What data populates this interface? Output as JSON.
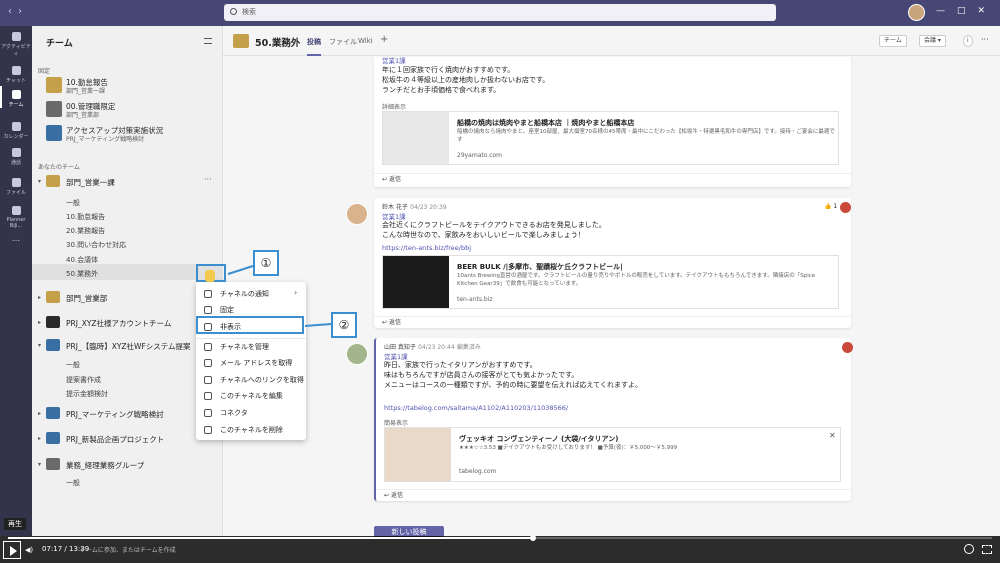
{
  "search": {
    "placeholder": "検索"
  },
  "rail": [
    {
      "label": "アクティビティ"
    },
    {
      "label": "チャット"
    },
    {
      "label": "チーム"
    },
    {
      "label": "カレンダー"
    },
    {
      "label": "通話"
    },
    {
      "label": "ファイル"
    },
    {
      "label": "Planner BiJi..."
    },
    {
      "label": "..."
    }
  ],
  "teams_panel": {
    "title": "チーム",
    "section_pinned": "固定",
    "section_yours": "あなたのチーム",
    "pinned": [
      {
        "name": "10.勤怠報告",
        "sub": "部門_営業一課"
      },
      {
        "name": "00.管理職限定",
        "sub": "部門_営業部"
      },
      {
        "name": "アクセスアップ対策実施状況",
        "sub": "PRJ_マーケティング戦略検討"
      }
    ],
    "team_eigyo1": "部門_営業一課",
    "channels_eigyo1": [
      "一般",
      "10.勤怠報告",
      "20.業務報告",
      "30.問い合わせ対応",
      "40.会議体",
      "50.業務外"
    ],
    "team_eigyobu": "部門_営業部",
    "team_xyz_account": "PRJ_XYZ社様アカウントチーム",
    "team_xyz_wf": "PRJ_【臨時】XYZ社WFシステム提案",
    "channels_xyz_wf": [
      "一般",
      "提案書作成",
      "提示金額検討"
    ],
    "team_marketing": "PRJ_マーケティング戦略検討",
    "team_newproduct": "PRJ_新製品企画プロジェクト",
    "team_keiri": "業務_経理業務グループ",
    "channels_keiri": [
      "一般"
    ],
    "join_text": "チームに参加、またはチームを作成"
  },
  "header": {
    "channel_title": "50.業務外",
    "tabs": [
      "投稿",
      "ファイル",
      "Wiki"
    ],
    "add": "+",
    "team_btn": "チーム",
    "meeting_btn": "会議"
  },
  "posts": [
    {
      "subject": "営業1課",
      "body": [
        "年に１回家族で行く焼肉がおすすめです。",
        "松坂牛の４等級以上の産地肉しか扱わないお店です。",
        "ランチだとお手頃価格で食べれます。"
      ],
      "detail_label": "詳細表示",
      "preview_title": "船橋の焼肉は焼肉やまと船橋本店 ｜焼肉やまと船橋本店",
      "preview_desc": "船橋の焼肉なら焼肉やまと。座室10部屋、最大個室70名様の45帯席・最中にこだわった【松坂牛・特選黒毛和牛の専門店】です。接待・ご宴会に最適です",
      "preview_domain": "29yamato.com",
      "reply": "返信"
    },
    {
      "author": "鈴木 花子",
      "time": "04/23 20:39",
      "subject": "営業1課",
      "body": [
        "会社近くにクラフトビールをテイクアウトできるお店を発見しました。",
        "こんな時世なので、家飲みをおいしいビールで楽しみましょう！"
      ],
      "link": "https://ten-ants.biz/free/bbj",
      "preview_title": "BEER BULK /|多摩市、聖蹟桜ケ丘クラフトビール|",
      "preview_desc": "10ants Brewing直営の酒屋です。クラフトビールの量り売りやボトルの販売をしています。テイクアウトももちろんできます。隣接店の「Spice Kitchen Gear39」で飲食も可能となっています。",
      "preview_domain": "ten-ants.biz",
      "reaction_count": "1",
      "reply": "返信"
    },
    {
      "author": "山田 真知子",
      "time": "04/23 20:44",
      "edited": "編集済み",
      "subject": "営業1課",
      "body": [
        "昨日、家族で行ったイタリアンがおすすめです。",
        "味はもちろんですが店員さんの接客がとても気よかったです。",
        "メニューはコースの一種類ですが、予約の時に要望を伝えれば応えてくれますよ。"
      ],
      "link": "https://tabelog.com/saitama/A1102/A110203/11038566/",
      "detail_label": "簡易表示",
      "preview_title": "ヴェッキオ コンヴェンティーノ (大袋/イタリアン)",
      "preview_desc": "★★★☆☆3.53 ■テイクアウトもお受けしております！ ■予算(夜)：￥5,000～￥5,999",
      "preview_domain": "tabelog.com",
      "reply": "返信"
    }
  ],
  "context_menu": [
    {
      "label": "チャネルの通知",
      "has_sub": true
    },
    {
      "label": "固定"
    },
    {
      "label": "非表示"
    },
    {
      "label": "チャネルを管理"
    },
    {
      "label": "メール アドレスを取得"
    },
    {
      "label": "チャネルへのリンクを取得"
    },
    {
      "label": "このチャネルを編集"
    },
    {
      "label": "コネクタ"
    },
    {
      "label": "このチャネルを削除"
    }
  ],
  "callouts": {
    "one": "①",
    "two": "②"
  },
  "new_post": "新しい投稿",
  "video": {
    "play_tooltip": "再生",
    "current": "07:17",
    "separator": "/",
    "duration": "13:39",
    "progress": 0.534
  },
  "colors": {
    "brand": "#464775",
    "accent": "#6264a7",
    "callout": "#3b8ed0"
  }
}
